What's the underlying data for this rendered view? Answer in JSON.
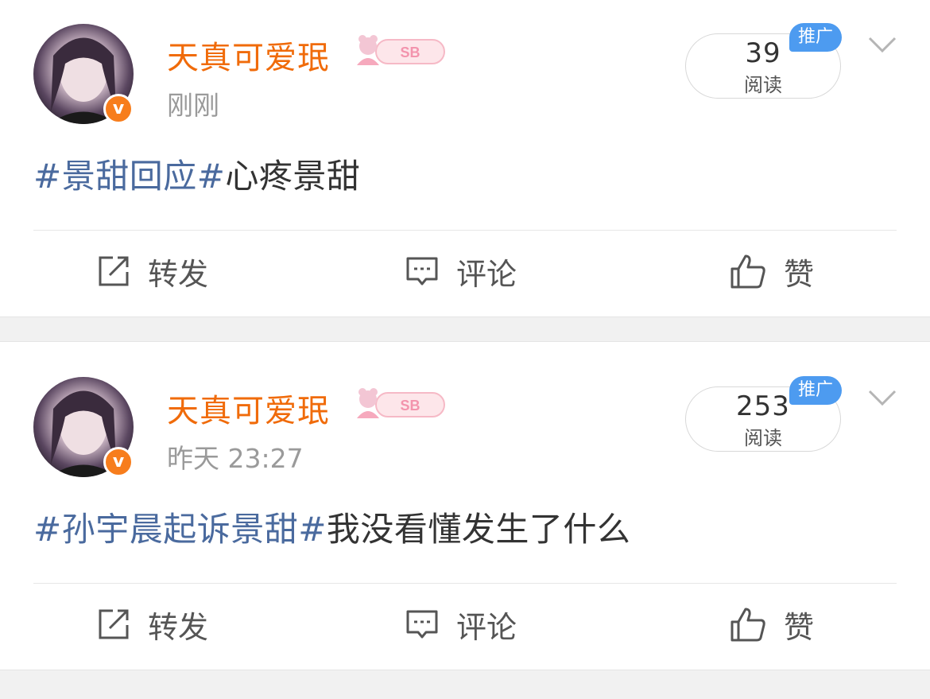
{
  "colors": {
    "username": "#f06b0a",
    "hashtag": "#4a6a9e",
    "promo_badge": "#4d9bf0",
    "verified_badge": "#f77d1c"
  },
  "posts": [
    {
      "username": "天真可爱珉",
      "verified_mark": "v",
      "time": "刚刚",
      "read_count": "39",
      "read_label": "阅读",
      "promo_label": "推广",
      "content_tag": "#景甜回应#",
      "content_text": "心疼景甜",
      "actions": {
        "repost": "转发",
        "comment": "评论",
        "like": "赞"
      }
    },
    {
      "username": "天真可爱珉",
      "verified_mark": "v",
      "time": "昨天 23:27",
      "read_count": "253",
      "read_label": "阅读",
      "promo_label": "推广",
      "content_tag": "#孙宇晨起诉景甜#",
      "content_text": "我没看懂发生了什么",
      "actions": {
        "repost": "转发",
        "comment": "评论",
        "like": "赞"
      }
    }
  ],
  "medal_text": "SB",
  "icons": [
    "repost-icon",
    "comment-icon",
    "like-icon",
    "chevron-down-icon",
    "verified-badge-icon"
  ]
}
